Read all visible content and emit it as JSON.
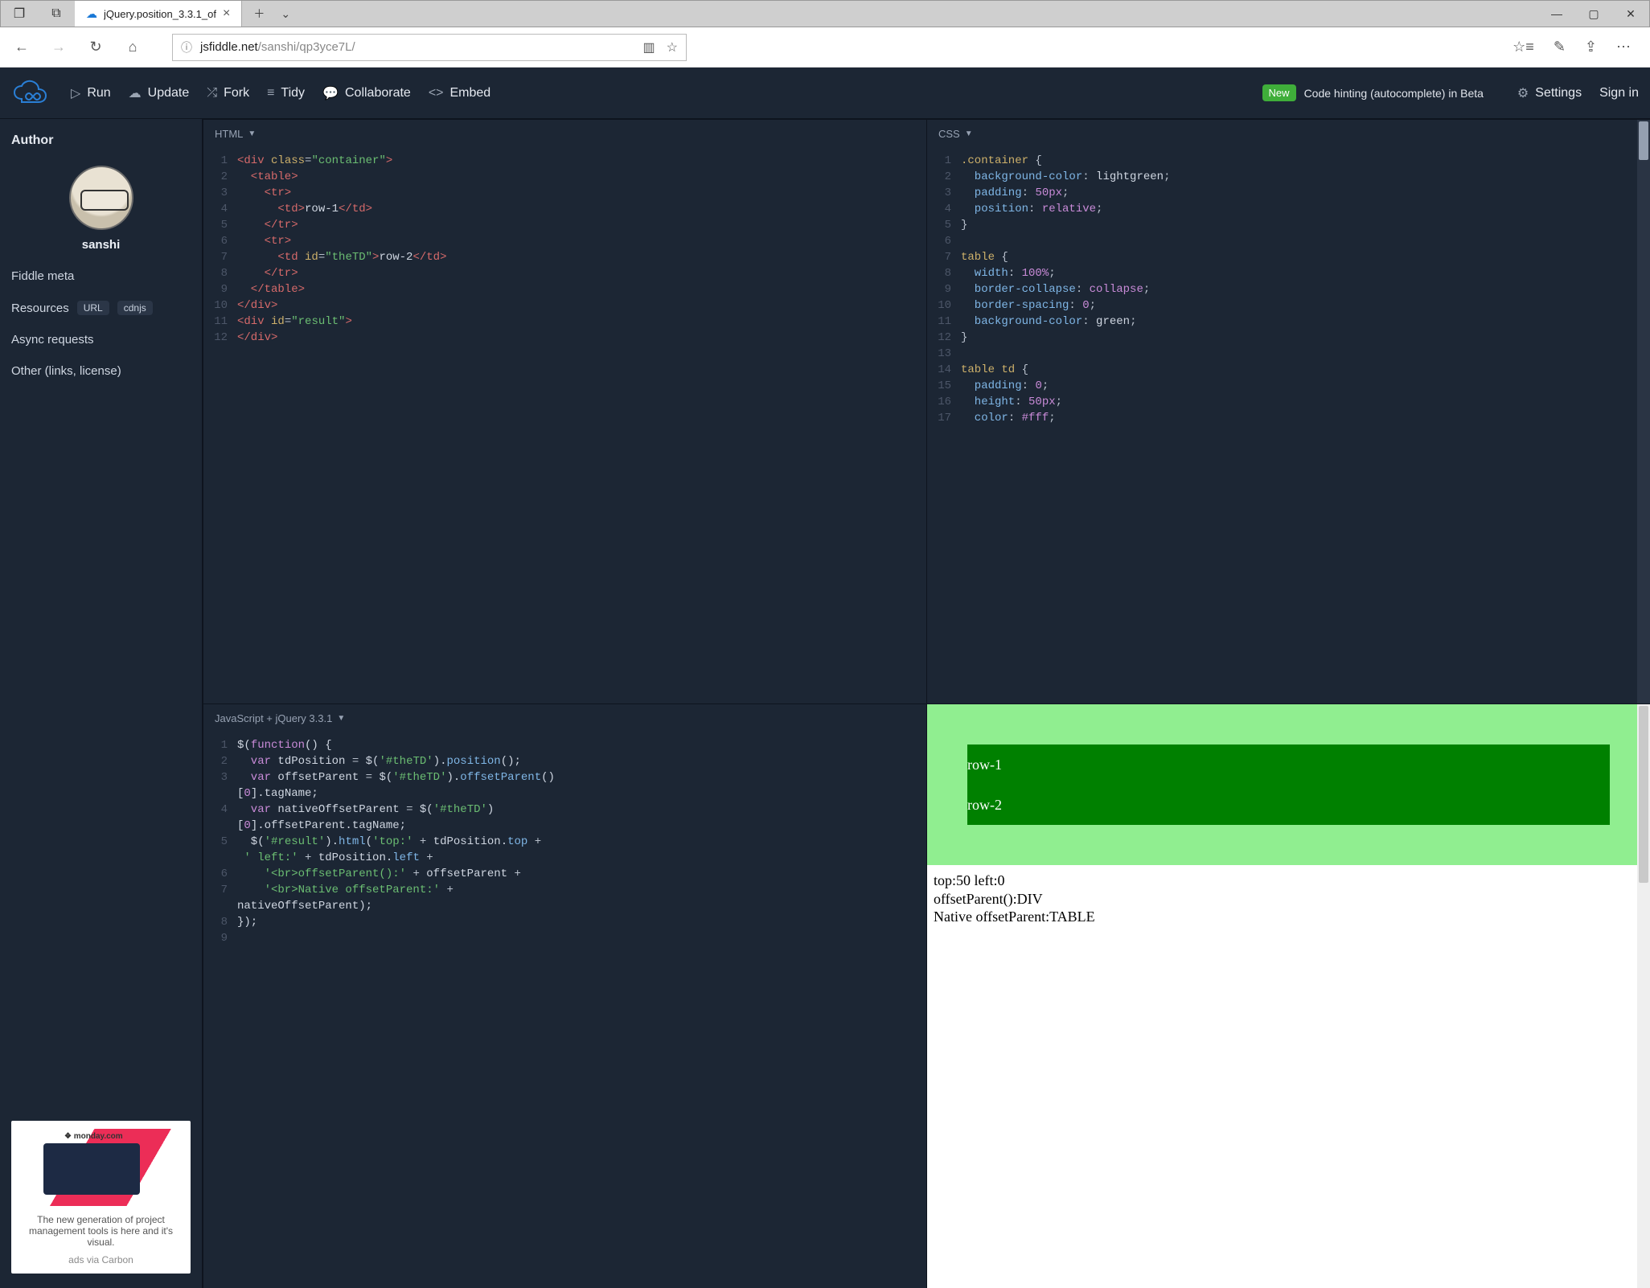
{
  "browser": {
    "tab_title": "jQuery.position_3.3.1_of",
    "url_host": "jsfiddle.net",
    "url_path": "/sanshi/qp3yce7L/"
  },
  "header": {
    "run": "Run",
    "update": "Update",
    "fork": "Fork",
    "tidy": "Tidy",
    "collaborate": "Collaborate",
    "embed": "Embed",
    "new": "New",
    "hinting": "Code hinting (autocomplete) in Beta",
    "settings": "Settings",
    "signin": "Sign in"
  },
  "sidebar": {
    "author_label": "Author",
    "author_name": "sanshi",
    "fiddle_meta": "Fiddle meta",
    "resources": "Resources",
    "pill_url": "URL",
    "pill_cdnjs": "cdnjs",
    "async": "Async requests",
    "other": "Other (links, license)",
    "ad_logo": "❖ monday.com",
    "ad_text": "The new generation of project management tools is here and it's visual.",
    "ad_tag": "ads via Carbon"
  },
  "panes": {
    "html_title": "HTML",
    "css_title": "CSS",
    "js_title": "JavaScript + jQuery 3.3.1"
  },
  "code": {
    "html": [
      [
        [
          "tag",
          "<div "
        ],
        [
          "attr",
          "class"
        ],
        [
          "punc",
          "="
        ],
        [
          "str",
          "\"container\""
        ],
        [
          "tag",
          ">"
        ]
      ],
      [
        [
          "tag",
          "  <table>"
        ]
      ],
      [
        [
          "tag",
          "    <tr>"
        ]
      ],
      [
        [
          "tag",
          "      <td>"
        ],
        [
          "plain",
          "row-1"
        ],
        [
          "tag",
          "</td>"
        ]
      ],
      [
        [
          "tag",
          "    </tr>"
        ]
      ],
      [
        [
          "tag",
          "    <tr>"
        ]
      ],
      [
        [
          "tag",
          "      <td "
        ],
        [
          "attr",
          "id"
        ],
        [
          "punc",
          "="
        ],
        [
          "str",
          "\"theTD\""
        ],
        [
          "tag",
          ">"
        ],
        [
          "plain",
          "row-2"
        ],
        [
          "tag",
          "</td>"
        ]
      ],
      [
        [
          "tag",
          "    </tr>"
        ]
      ],
      [
        [
          "tag",
          "  </table>"
        ]
      ],
      [
        [
          "tag",
          "</div>"
        ]
      ],
      [
        [
          "tag",
          "<div "
        ],
        [
          "attr",
          "id"
        ],
        [
          "punc",
          "="
        ],
        [
          "str",
          "\"result\""
        ],
        [
          "tag",
          ">"
        ]
      ],
      [
        [
          "tag",
          "</div>"
        ]
      ]
    ],
    "css": [
      [
        [
          "sel",
          ".container "
        ],
        [
          "punc",
          "{"
        ]
      ],
      [
        [
          "prop",
          "  background-color"
        ],
        [
          "punc",
          ": "
        ],
        [
          "plain",
          "lightgreen"
        ],
        [
          "punc",
          ";"
        ]
      ],
      [
        [
          "prop",
          "  padding"
        ],
        [
          "punc",
          ": "
        ],
        [
          "num",
          "50px"
        ],
        [
          "punc",
          ";"
        ]
      ],
      [
        [
          "prop",
          "  position"
        ],
        [
          "punc",
          ": "
        ],
        [
          "kw",
          "relative"
        ],
        [
          "punc",
          ";"
        ]
      ],
      [
        [
          "punc",
          "}"
        ]
      ],
      [
        [
          "plain",
          ""
        ]
      ],
      [
        [
          "sel",
          "table "
        ],
        [
          "punc",
          "{"
        ]
      ],
      [
        [
          "prop",
          "  width"
        ],
        [
          "punc",
          ": "
        ],
        [
          "num",
          "100%"
        ],
        [
          "punc",
          ";"
        ]
      ],
      [
        [
          "prop",
          "  border-collapse"
        ],
        [
          "punc",
          ": "
        ],
        [
          "kw",
          "collapse"
        ],
        [
          "punc",
          ";"
        ]
      ],
      [
        [
          "prop",
          "  border-spacing"
        ],
        [
          "punc",
          ": "
        ],
        [
          "num",
          "0"
        ],
        [
          "punc",
          ";"
        ]
      ],
      [
        [
          "prop",
          "  background-color"
        ],
        [
          "punc",
          ": "
        ],
        [
          "plain",
          "green"
        ],
        [
          "punc",
          ";"
        ]
      ],
      [
        [
          "punc",
          "}"
        ]
      ],
      [
        [
          "plain",
          ""
        ]
      ],
      [
        [
          "sel",
          "table td "
        ],
        [
          "punc",
          "{"
        ]
      ],
      [
        [
          "prop",
          "  padding"
        ],
        [
          "punc",
          ": "
        ],
        [
          "num",
          "0"
        ],
        [
          "punc",
          ";"
        ]
      ],
      [
        [
          "prop",
          "  height"
        ],
        [
          "punc",
          ": "
        ],
        [
          "num",
          "50px"
        ],
        [
          "punc",
          ";"
        ]
      ],
      [
        [
          "prop",
          "  color"
        ],
        [
          "punc",
          ": "
        ],
        [
          "num",
          "#fff"
        ],
        [
          "punc",
          ";"
        ]
      ]
    ],
    "js": [
      [
        [
          "plain",
          "$("
        ],
        [
          "kw2",
          "function"
        ],
        [
          "plain",
          "() {"
        ]
      ],
      [
        [
          "kw2",
          "  var "
        ],
        [
          "plain",
          "tdPosition "
        ],
        [
          "punc",
          "= "
        ],
        [
          "plain",
          "$("
        ],
        [
          "str",
          "'#theTD'"
        ],
        [
          "plain",
          ")."
        ],
        [
          "fn",
          "position"
        ],
        [
          "plain",
          "();"
        ]
      ],
      [
        [
          "kw2",
          "  var "
        ],
        [
          "plain",
          "offsetParent "
        ],
        [
          "punc",
          "= "
        ],
        [
          "plain",
          "$("
        ],
        [
          "str",
          "'#theTD'"
        ],
        [
          "plain",
          ")."
        ],
        [
          "fn",
          "offsetParent"
        ],
        [
          "plain",
          "()"
        ]
      ],
      [
        [
          "plain",
          "["
        ],
        [
          "num",
          "0"
        ],
        [
          "plain",
          "].tagName;"
        ]
      ],
      [
        [
          "kw2",
          "  var "
        ],
        [
          "plain",
          "nativeOffsetParent "
        ],
        [
          "punc",
          "= "
        ],
        [
          "plain",
          "$("
        ],
        [
          "str",
          "'#theTD'"
        ],
        [
          "plain",
          ")"
        ]
      ],
      [
        [
          "plain",
          "["
        ],
        [
          "num",
          "0"
        ],
        [
          "plain",
          "].offsetParent.tagName;"
        ]
      ],
      [
        [
          "plain",
          "  $("
        ],
        [
          "str",
          "'#result'"
        ],
        [
          "plain",
          ")."
        ],
        [
          "fn",
          "html"
        ],
        [
          "plain",
          "("
        ],
        [
          "str",
          "'top:'"
        ],
        [
          "plain",
          " "
        ],
        [
          "punc",
          "+"
        ],
        [
          "plain",
          " tdPosition."
        ],
        [
          "var",
          "top"
        ],
        [
          "plain",
          " "
        ],
        [
          "punc",
          "+"
        ]
      ],
      [
        [
          "str",
          " ' left:'"
        ],
        [
          "plain",
          " "
        ],
        [
          "punc",
          "+"
        ],
        [
          "plain",
          " tdPosition."
        ],
        [
          "var",
          "left"
        ],
        [
          "plain",
          " "
        ],
        [
          "punc",
          "+"
        ]
      ],
      [
        [
          "str",
          "    '<br>offsetParent():'"
        ],
        [
          "plain",
          " "
        ],
        [
          "punc",
          "+"
        ],
        [
          "plain",
          " offsetParent "
        ],
        [
          "punc",
          "+"
        ]
      ],
      [
        [
          "str",
          "    '<br>Native offsetParent:'"
        ],
        [
          "plain",
          " "
        ],
        [
          "punc",
          "+"
        ]
      ],
      [
        [
          "plain",
          "nativeOffsetParent);"
        ]
      ],
      [
        [
          "plain",
          "});"
        ]
      ],
      [
        [
          "plain",
          ""
        ]
      ]
    ],
    "js_linenums": [
      1,
      2,
      3,
      "",
      4,
      "",
      5,
      "",
      6,
      7,
      "",
      8,
      9
    ]
  },
  "result": {
    "row1": "row-1",
    "row2": "row-2",
    "out1": "top:50 left:0",
    "out2": "offsetParent():DIV",
    "out3": "Native offsetParent:TABLE"
  }
}
